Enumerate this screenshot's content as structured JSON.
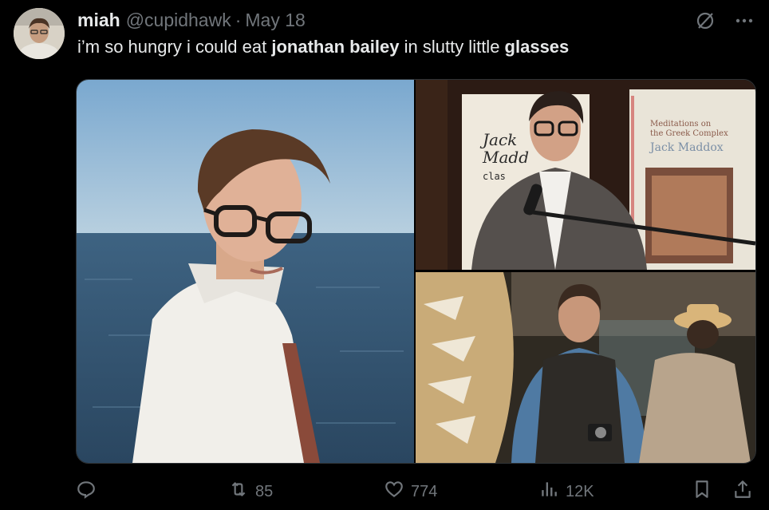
{
  "tweet": {
    "author_name": "miah",
    "author_handle": "@cupidhawk",
    "separator": "·",
    "date": "May 18",
    "text_part1": "i’m so hungry i could eat ",
    "text_bold1": "jonathan bailey",
    "text_part2": " in slutty little ",
    "text_bold2": "glasses"
  },
  "photos": {
    "book_left": {
      "line1": "Jack",
      "line2": "Madd",
      "line3": "clas"
    },
    "book_right": {
      "line1": "Meditations on",
      "line2": "the Greek Complex",
      "author": "Jack Maddox"
    }
  },
  "actions": {
    "reply_count": "",
    "retweet_count": "85",
    "like_count": "774",
    "views_count": "12K"
  },
  "icons": [
    "reply-icon",
    "retweet-icon",
    "like-icon",
    "views-icon",
    "bookmark-icon",
    "share-icon",
    "grok-icon",
    "more-icon"
  ],
  "colors": {
    "background": "#000000",
    "text": "#e7e9ea",
    "muted": "#71767b"
  }
}
